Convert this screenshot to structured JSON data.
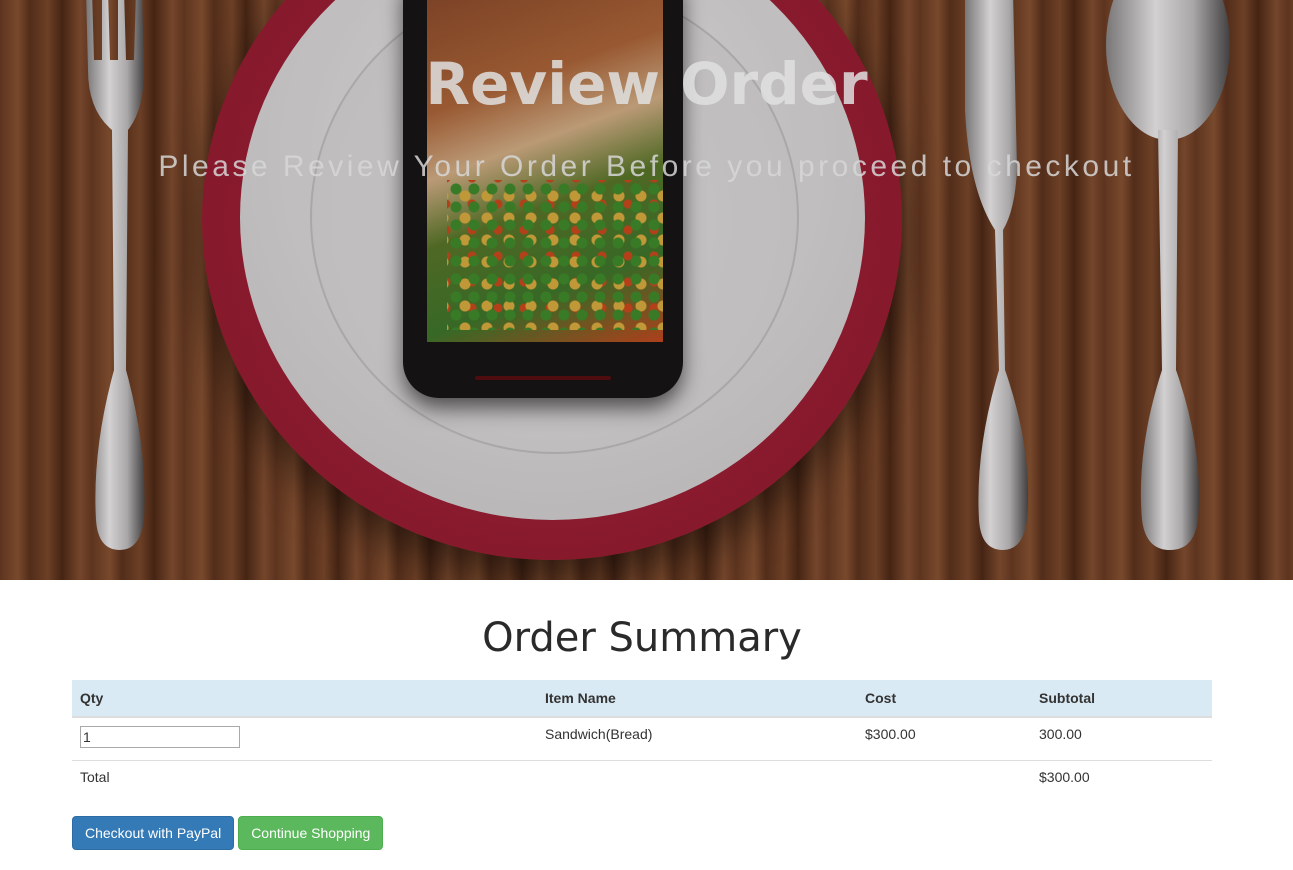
{
  "hero": {
    "title": "Review Order",
    "subtitle": "Please Review Your Order Before you proceed to checkout"
  },
  "summary": {
    "heading": "Order Summary",
    "columns": [
      "Qty",
      "Item Name",
      "Cost",
      "Subtotal"
    ],
    "items": [
      {
        "qty": "1",
        "name": "Sandwich(Bread)",
        "cost": "$300.00",
        "subtotal": "300.00"
      }
    ],
    "total_label": "Total",
    "total_value": "$300.00"
  },
  "actions": {
    "checkout_label": "Checkout with PayPal",
    "continue_label": "Continue Shopping"
  },
  "colors": {
    "table_header_bg": "#d9eaf4",
    "primary_button": "#337ab7",
    "success_button": "#5cb85c"
  }
}
